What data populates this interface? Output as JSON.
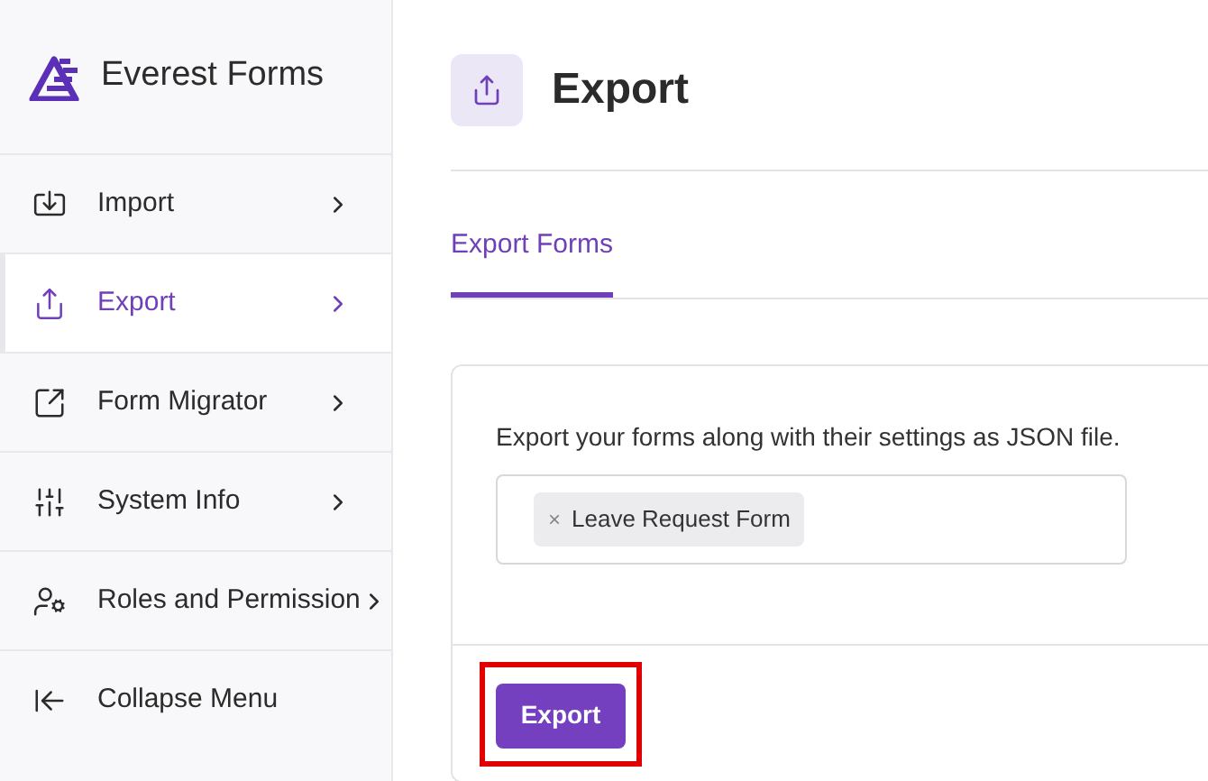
{
  "brand": {
    "name": "Everest Forms"
  },
  "menu": [
    {
      "label": "Import",
      "selected": false
    },
    {
      "label": "Export",
      "selected": true
    },
    {
      "label": "Form Migrator",
      "selected": false
    },
    {
      "label": "System Info",
      "selected": false
    },
    {
      "label": "Roles and Permission",
      "selected": false
    }
  ],
  "collapse": {
    "label": "Collapse Menu"
  },
  "page": {
    "title": "Export"
  },
  "tabs": [
    {
      "label": "Export Forms",
      "selected": true
    }
  ],
  "card": {
    "description": "Export your forms along with their settings as JSON file.",
    "selected_forms": [
      {
        "remove": "×",
        "label": "Leave Request Form"
      }
    ],
    "button": {
      "label": "Export",
      "highlighted": true
    }
  }
}
